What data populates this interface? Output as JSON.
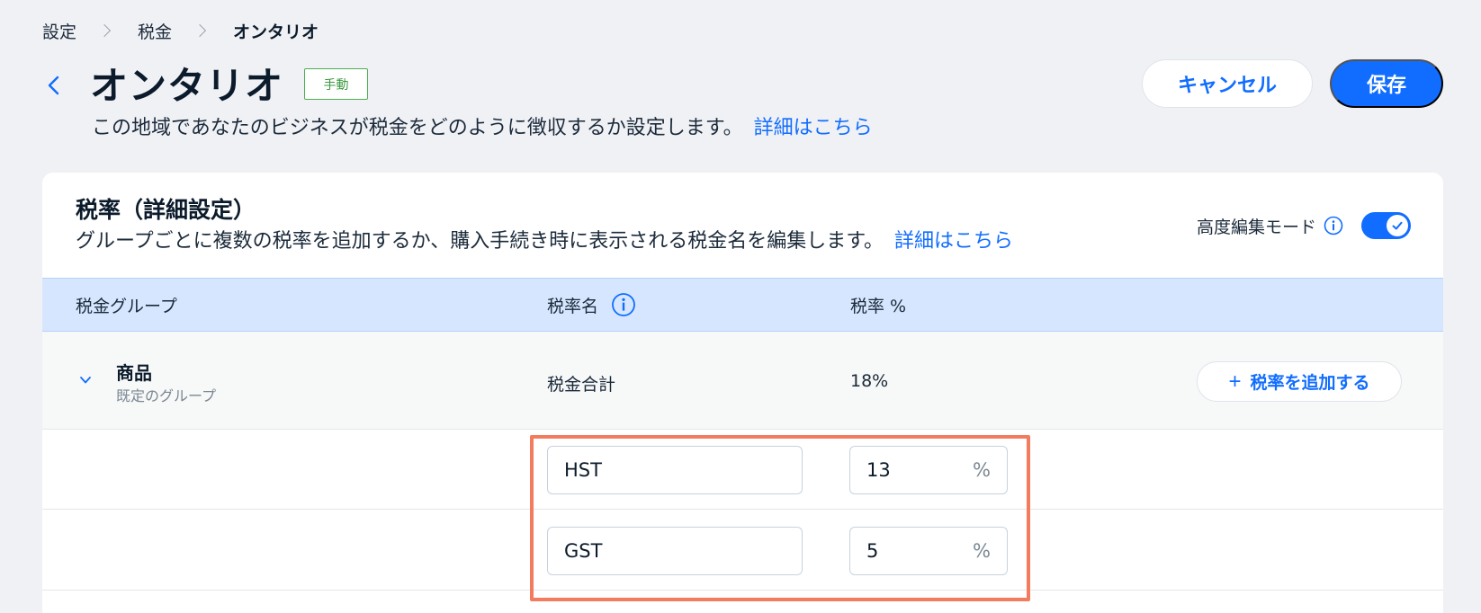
{
  "breadcrumb": {
    "items": [
      "設定",
      "税金",
      "オンタリオ"
    ]
  },
  "header": {
    "title": "オンタリオ",
    "badge": "手動",
    "subtitle": "この地域であなたのビジネスが税金をどのように徴収するか設定します。",
    "subtitle_link": "詳細はこちら",
    "cancel_label": "キャンセル",
    "save_label": "保存"
  },
  "card": {
    "title": "税率（詳細設定）",
    "description": "グループごとに複数の税率を追加するか、購入手続き時に表示される税金名を編集します。",
    "description_link": "詳細はこちら",
    "advanced_mode_label": "高度編集モード",
    "advanced_mode_on": true
  },
  "table": {
    "columns": [
      "税金グループ",
      "税率名",
      "税率 %"
    ],
    "group": {
      "name": "商品",
      "subtitle": "既定のグループ",
      "total_name": "税金合計",
      "total_rate": "18%",
      "add_rate_label": "税率を追加する"
    },
    "rates": [
      {
        "name": "HST",
        "rate": "13",
        "unit": "%"
      },
      {
        "name": "GST",
        "rate": "5",
        "unit": "%"
      }
    ]
  },
  "colors": {
    "accent": "#116dff",
    "badge": "#4caf50",
    "highlight": "#f37b5e",
    "table_header": "#d6e6fe"
  }
}
